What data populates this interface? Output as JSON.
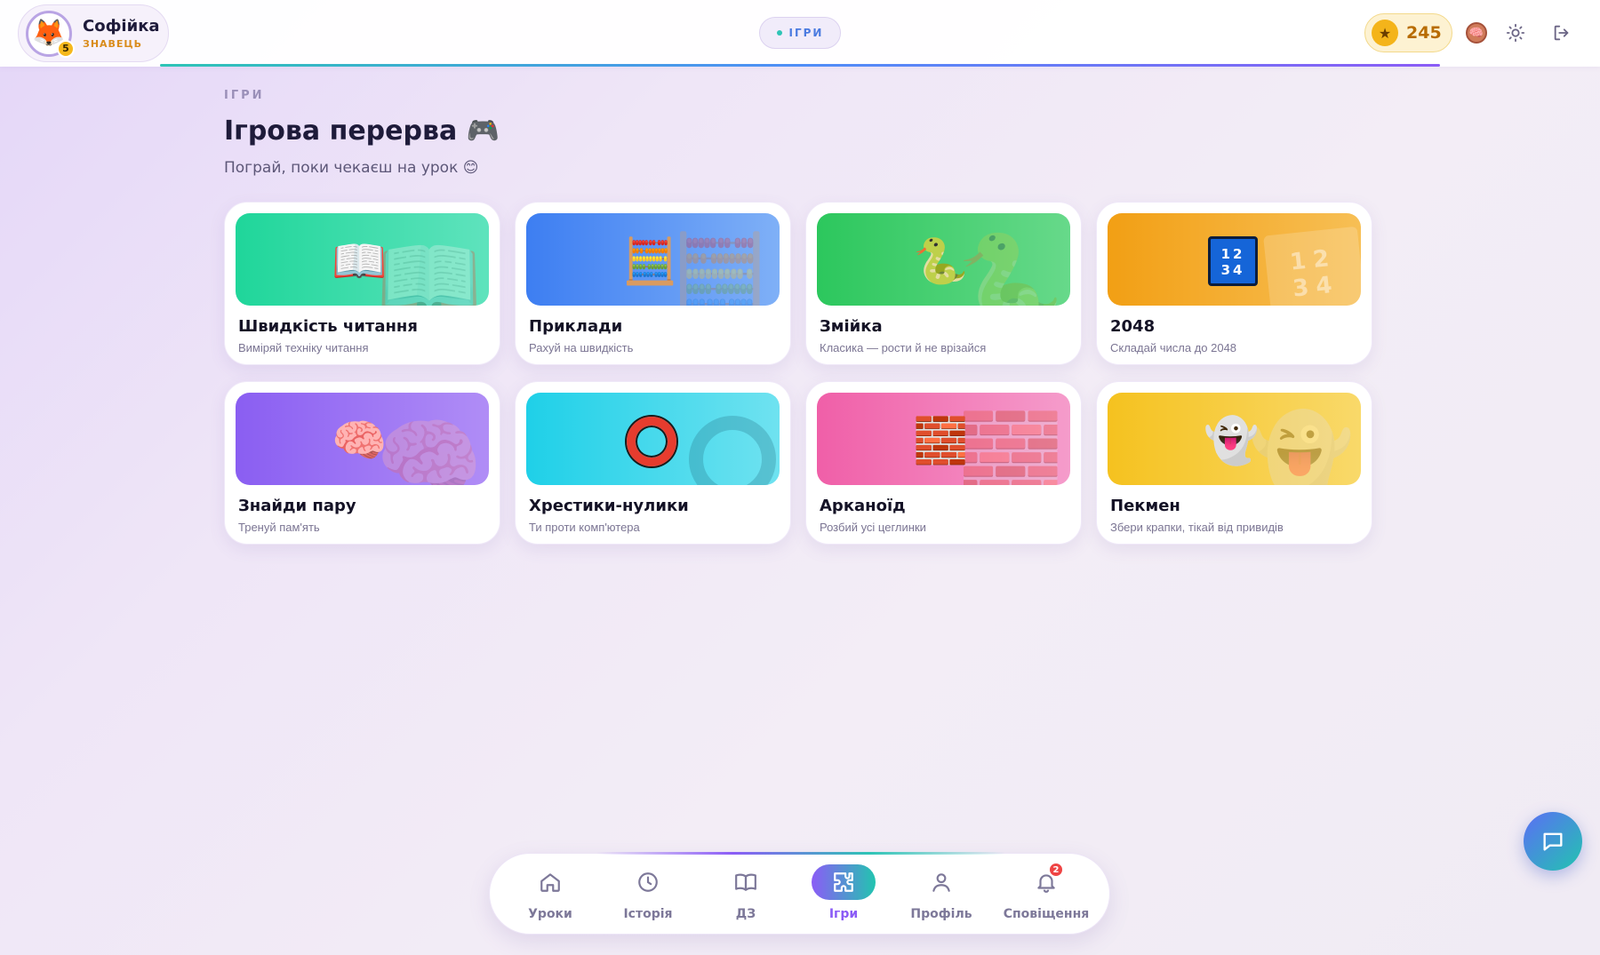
{
  "header": {
    "user": {
      "name": "Софійка",
      "rank": "ЗНАВЕЦЬ",
      "level": "5",
      "avatar_icon": "fox-icon"
    },
    "section_pill": "ІГРИ",
    "coins": "245",
    "icons": [
      "brain-icon",
      "sun-icon",
      "logout-icon"
    ]
  },
  "main": {
    "eyebrow": "ІГРИ",
    "title": "Ігрова перерва 🎮",
    "subtitle": "Пограй, поки чекаєш на урок 😊"
  },
  "games": [
    {
      "title": "Швидкість читання",
      "desc": "Виміряй техніку читання",
      "emoji": "📖",
      "color": "#1fd69a"
    },
    {
      "title": "Приклади",
      "desc": "Рахуй на швидкість",
      "emoji": "🧮",
      "color": "#3d7ef2"
    },
    {
      "title": "Змійка",
      "desc": "Класика — рости й не врізайся",
      "emoji": "🐍",
      "color": "#2cc75d"
    },
    {
      "title": "2048",
      "desc": "Складай числа до 2048",
      "tile": "12 34",
      "color": "#f29f14"
    },
    {
      "title": "Знайди пару",
      "desc": "Тренуй пам'ять",
      "emoji": "🧠",
      "color": "#8a5ef2"
    },
    {
      "title": "Хрестики-нулики",
      "desc": "Ти проти комп'ютера",
      "emoji": "⭕",
      "color": "#1fd0e8"
    },
    {
      "title": "Арканоїд",
      "desc": "Розбий усі цеглинки",
      "emoji": "🧱",
      "color": "#f05fa8"
    },
    {
      "title": "Пекмен",
      "desc": "Збери крапки, тікай від привидів",
      "emoji": "👻",
      "color": "#f5c21f"
    }
  ],
  "bottom_nav": {
    "items": [
      {
        "label": "Уроки",
        "icon": "home-icon"
      },
      {
        "label": "Історія",
        "icon": "clock-icon"
      },
      {
        "label": "ДЗ",
        "icon": "book-icon"
      },
      {
        "label": "Ігри",
        "icon": "puzzle-icon",
        "active": true
      },
      {
        "label": "Профіль",
        "icon": "user-icon"
      },
      {
        "label": "Сповіщення",
        "icon": "bell-icon",
        "badge": "2"
      }
    ]
  },
  "colors": {
    "accent": "#8b5cf6",
    "teal": "#22c4b0",
    "coin": "#f4b41a"
  }
}
